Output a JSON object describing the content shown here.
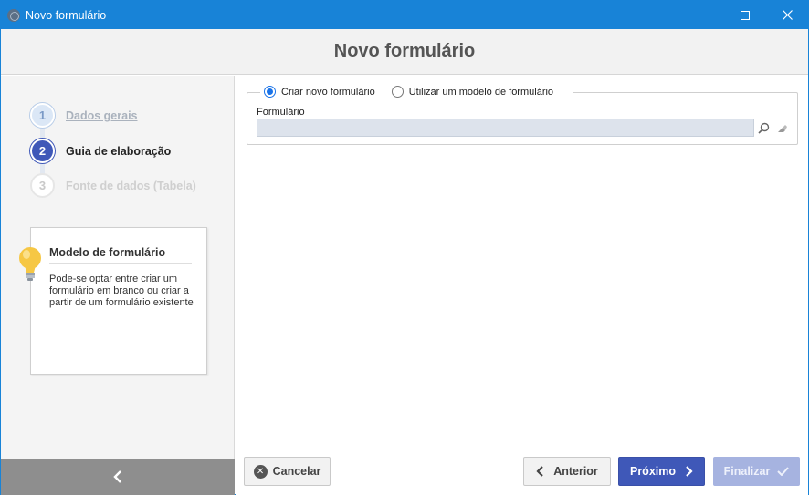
{
  "window": {
    "title": "Novo formulário"
  },
  "header": {
    "title": "Novo formulário"
  },
  "steps": [
    {
      "number": "1",
      "label": "Dados gerais",
      "state": "done"
    },
    {
      "number": "2",
      "label": "Guia de elaboração",
      "state": "active"
    },
    {
      "number": "3",
      "label": "Fonte de dados (Tabela)",
      "state": "todo"
    }
  ],
  "info": {
    "title": "Modelo de formulário",
    "text": "Pode-se optar entre criar um formulário em branco ou criar a partir de um formulário existente"
  },
  "options": {
    "create_new": "Criar novo formulário",
    "use_template": "Utilizar um modelo de formulário",
    "selected": "create_new"
  },
  "form_field": {
    "label": "Formulário",
    "value": ""
  },
  "buttons": {
    "cancel": "Cancelar",
    "previous": "Anterior",
    "next": "Próximo",
    "finish": "Finalizar"
  },
  "colors": {
    "titlebar": "#1883d7",
    "primary": "#3f58b8",
    "disabled_primary": "#a6b3e0"
  }
}
